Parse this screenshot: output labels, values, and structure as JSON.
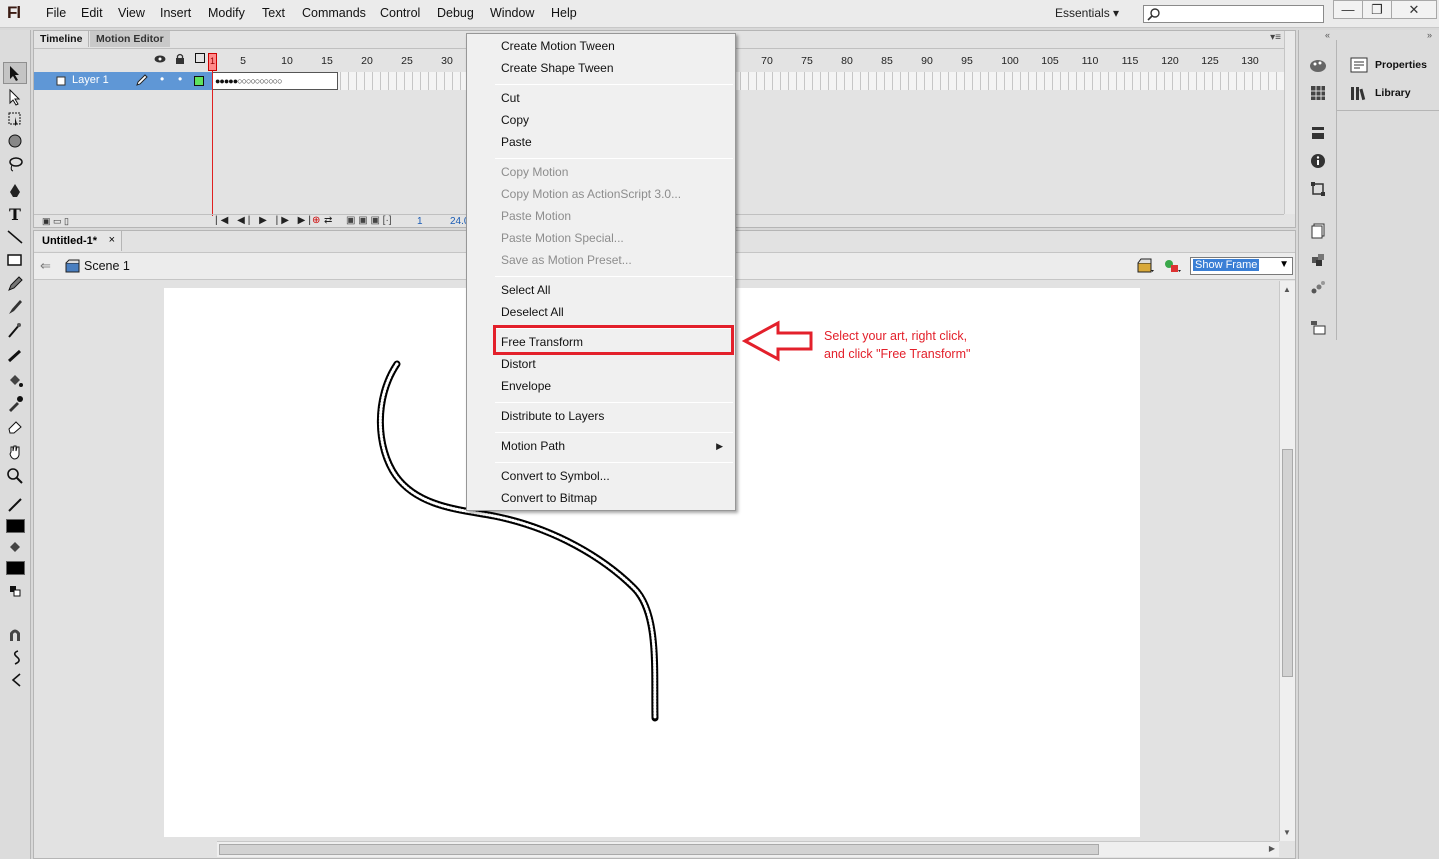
{
  "app": {
    "logo": "Fl"
  },
  "menu": [
    "File",
    "Edit",
    "View",
    "Insert",
    "Modify",
    "Text",
    "Commands",
    "Control",
    "Debug",
    "Window",
    "Help"
  ],
  "workspace": "Essentials",
  "window_controls": {
    "minimize": "—",
    "restore": "❐",
    "close": "✕"
  },
  "timeline": {
    "tabs": [
      "Timeline",
      "Motion Editor"
    ],
    "layer_name": "Layer 1",
    "playhead_frame": "1",
    "ruler": [
      "5",
      "10",
      "15",
      "20",
      "25",
      "30",
      "70",
      "75",
      "80",
      "85",
      "90",
      "95",
      "100",
      "105",
      "110",
      "115",
      "120",
      "125",
      "130"
    ],
    "current_frame": "1",
    "fps": "24.0"
  },
  "document": {
    "tab_title": "Untitled-1*",
    "tab_close": "×",
    "scene": "Scene 1",
    "zoom": "Show Frame"
  },
  "panels": {
    "properties": "Properties",
    "library": "Library"
  },
  "context_menu": {
    "groups": [
      [
        {
          "label": "Create Motion Tween",
          "enabled": true
        },
        {
          "label": "Create Shape Tween",
          "enabled": true
        }
      ],
      [
        {
          "label": "Cut",
          "enabled": true
        },
        {
          "label": "Copy",
          "enabled": true
        },
        {
          "label": "Paste",
          "enabled": true
        }
      ],
      [
        {
          "label": "Copy Motion",
          "enabled": false
        },
        {
          "label": "Copy Motion as ActionScript 3.0...",
          "enabled": false
        },
        {
          "label": "Paste Motion",
          "enabled": false
        },
        {
          "label": "Paste Motion Special...",
          "enabled": false
        },
        {
          "label": "Save as Motion Preset...",
          "enabled": false
        }
      ],
      [
        {
          "label": "Select All",
          "enabled": true
        },
        {
          "label": "Deselect All",
          "enabled": true
        }
      ],
      [
        {
          "label": "Free Transform",
          "enabled": true
        },
        {
          "label": "Distort",
          "enabled": true
        },
        {
          "label": "Envelope",
          "enabled": true
        }
      ],
      [
        {
          "label": "Distribute to Layers",
          "enabled": true
        }
      ],
      [
        {
          "label": "Motion Path",
          "enabled": true,
          "submenu": true
        }
      ],
      [
        {
          "label": "Convert to Symbol...",
          "enabled": true
        },
        {
          "label": "Convert to Bitmap",
          "enabled": true
        }
      ]
    ]
  },
  "annotation": {
    "line1": "Select your art, right click,",
    "line2": "and click \"Free Transform\"",
    "color": "#e3202b"
  }
}
